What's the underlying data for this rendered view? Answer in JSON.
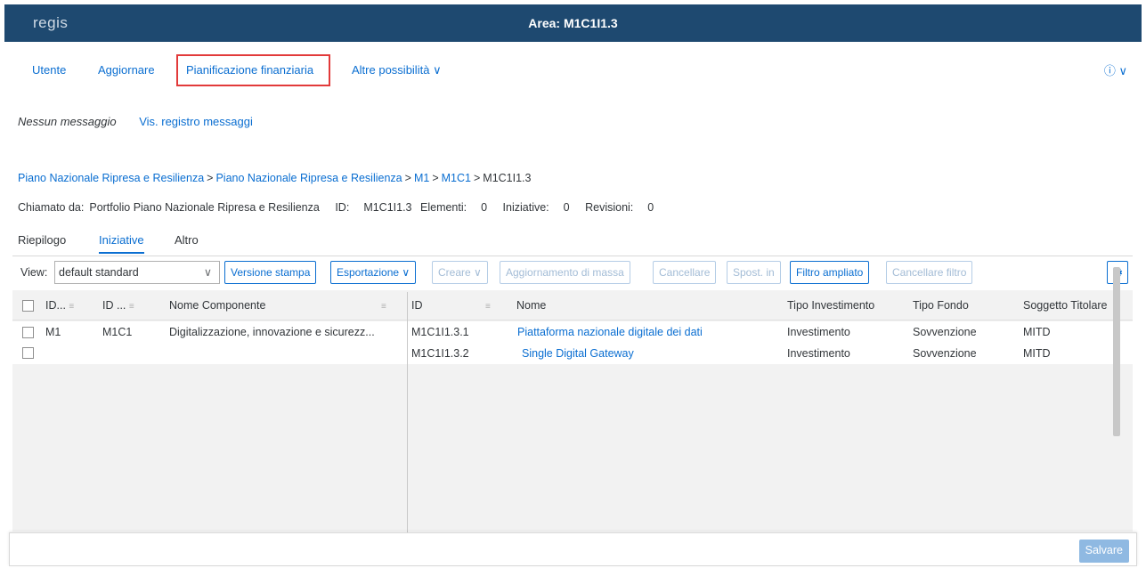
{
  "shell": {
    "logo": "regis",
    "title": "Area: M1C1I1.3"
  },
  "toolbar": {
    "items": [
      "Utente",
      "Aggiornare",
      "Pianificazione finanziaria",
      "Altre possibilità"
    ],
    "help_icon": "help-icon"
  },
  "messages": {
    "none": "Nessun messaggio",
    "log_link": "Vis. registro messaggi"
  },
  "breadcrumb": [
    "Piano Nazionale Ripresa e Resilienza",
    "Piano Nazionale Ripresa e Resilienza",
    "M1",
    "M1C1",
    "M1C1I1.3"
  ],
  "info": {
    "called_by_label": "Chiamato da:",
    "called_by_value": "Portfolio Piano Nazionale Ripresa e Resilienza",
    "id_label": "ID:",
    "id_value": "M1C1I1.3",
    "elements_label": "Elementi:",
    "elements_value": "0",
    "initiatives_label": "Iniziative:",
    "initiatives_value": "0",
    "revisions_label": "Revisioni:",
    "revisions_value": "0"
  },
  "tabs": [
    "Riepilogo",
    "Iniziative",
    "Altro"
  ],
  "table_toolbar": {
    "view_label": "View:",
    "view_value": "default standard",
    "buttons": [
      "Versione stampa",
      "Esportazione",
      "Creare",
      "Aggiornamento di massa",
      "Cancellare",
      "Spost. in",
      "Filtro ampliato",
      "Cancellare filtro"
    ]
  },
  "left_columns": [
    "ID...",
    "ID ...",
    "Nome Componente"
  ],
  "right_columns": [
    "ID",
    "Nome",
    "Tipo Investimento",
    "Tipo Fondo",
    "Soggetto Titolare"
  ],
  "left_rows": [
    [
      "M1",
      "M1C1",
      "Digitalizzazione, innovazione e sicurezz..."
    ],
    [
      "",
      "",
      ""
    ]
  ],
  "right_rows": [
    [
      "M1C1I1.3.1",
      "Piattaforma nazionale digitale dei dati",
      "Investimento",
      "Sovvenzione",
      "MITD"
    ],
    [
      "M1C1I1.3.2",
      "Single Digital Gateway",
      "Investimento",
      "Sovvenzione",
      "MITD"
    ]
  ],
  "footer": {
    "save": "Salvare"
  },
  "colors": {
    "shell": "#1e4970",
    "accent": "#0a6ed1",
    "highlight": "#e23a3a"
  }
}
